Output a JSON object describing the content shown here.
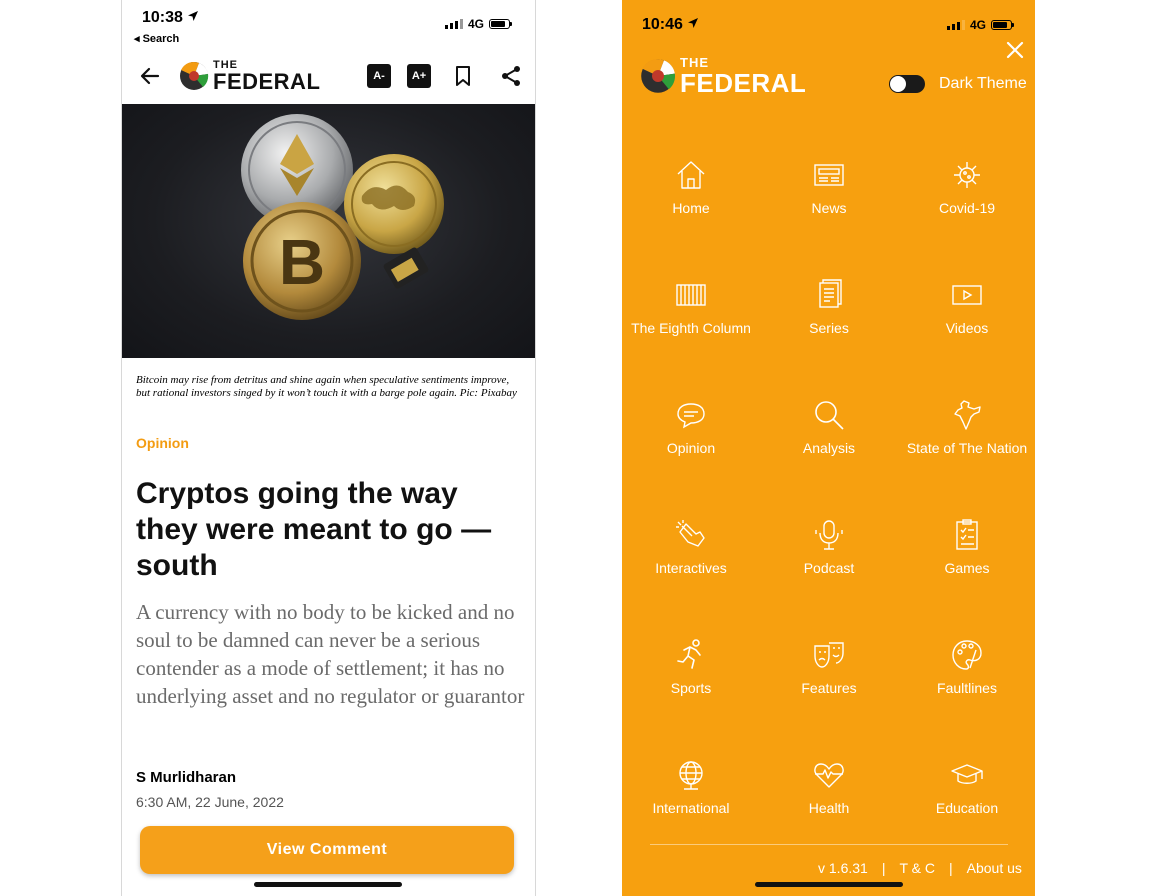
{
  "left": {
    "status": {
      "time": "10:38",
      "back_app": "◂ Search",
      "network": "4G"
    },
    "logo": {
      "the": "THE",
      "name": "FEDERAL"
    },
    "toolbar": {
      "font_decrease": "A-",
      "font_increase": "A+"
    },
    "image_caption": "Bitcoin may rise from detritus and shine again when speculative sentiments improve, but rational investors singed by it won’t touch it with a barge pole again. Pic: Pixabay",
    "category": "Opinion",
    "headline": "Cryptos going the way they were meant to go — south",
    "summary": "A currency with no body to be kicked and no soul to be damned can never be a serious contender as a mode of settlement; it has no underlying asset and no regulator or guarantor",
    "author": "S Murlidharan",
    "date": "6:30 AM, 22 June, 2022",
    "view_comment": "View Comment"
  },
  "right": {
    "status": {
      "time": "10:46",
      "network": "4G"
    },
    "logo": {
      "the": "THE",
      "name": "FEDERAL"
    },
    "dark_theme_label": "Dark Theme",
    "menu": [
      {
        "label": "Home",
        "icon": "home-icon"
      },
      {
        "label": "News",
        "icon": "newspaper-icon"
      },
      {
        "label": "Covid-19",
        "icon": "virus-icon"
      },
      {
        "label": "The Eighth Column",
        "icon": "columns-icon"
      },
      {
        "label": "Series",
        "icon": "series-icon"
      },
      {
        "label": "Videos",
        "icon": "video-icon"
      },
      {
        "label": "Opinion",
        "icon": "speech-bubble-icon"
      },
      {
        "label": "Analysis",
        "icon": "magnifier-icon"
      },
      {
        "label": "State of The Nation",
        "icon": "india-map-icon"
      },
      {
        "label": "Interactives",
        "icon": "tap-hand-icon"
      },
      {
        "label": "Podcast",
        "icon": "microphone-icon"
      },
      {
        "label": "Games",
        "icon": "checklist-icon"
      },
      {
        "label": "Sports",
        "icon": "runner-icon"
      },
      {
        "label": "Features",
        "icon": "theatre-masks-icon"
      },
      {
        "label": "Faultlines",
        "icon": "palette-icon"
      },
      {
        "label": "International",
        "icon": "globe-icon"
      },
      {
        "label": "Health",
        "icon": "heart-pulse-icon"
      },
      {
        "label": "Education",
        "icon": "graduation-cap-icon"
      }
    ],
    "footer": {
      "version": "v 1.6.31",
      "sep": "|",
      "terms": "T & C",
      "about": "About us"
    }
  },
  "colors": {
    "accent": "#f7a00f",
    "button": "#f5a01a",
    "category": "#f39c12"
  }
}
